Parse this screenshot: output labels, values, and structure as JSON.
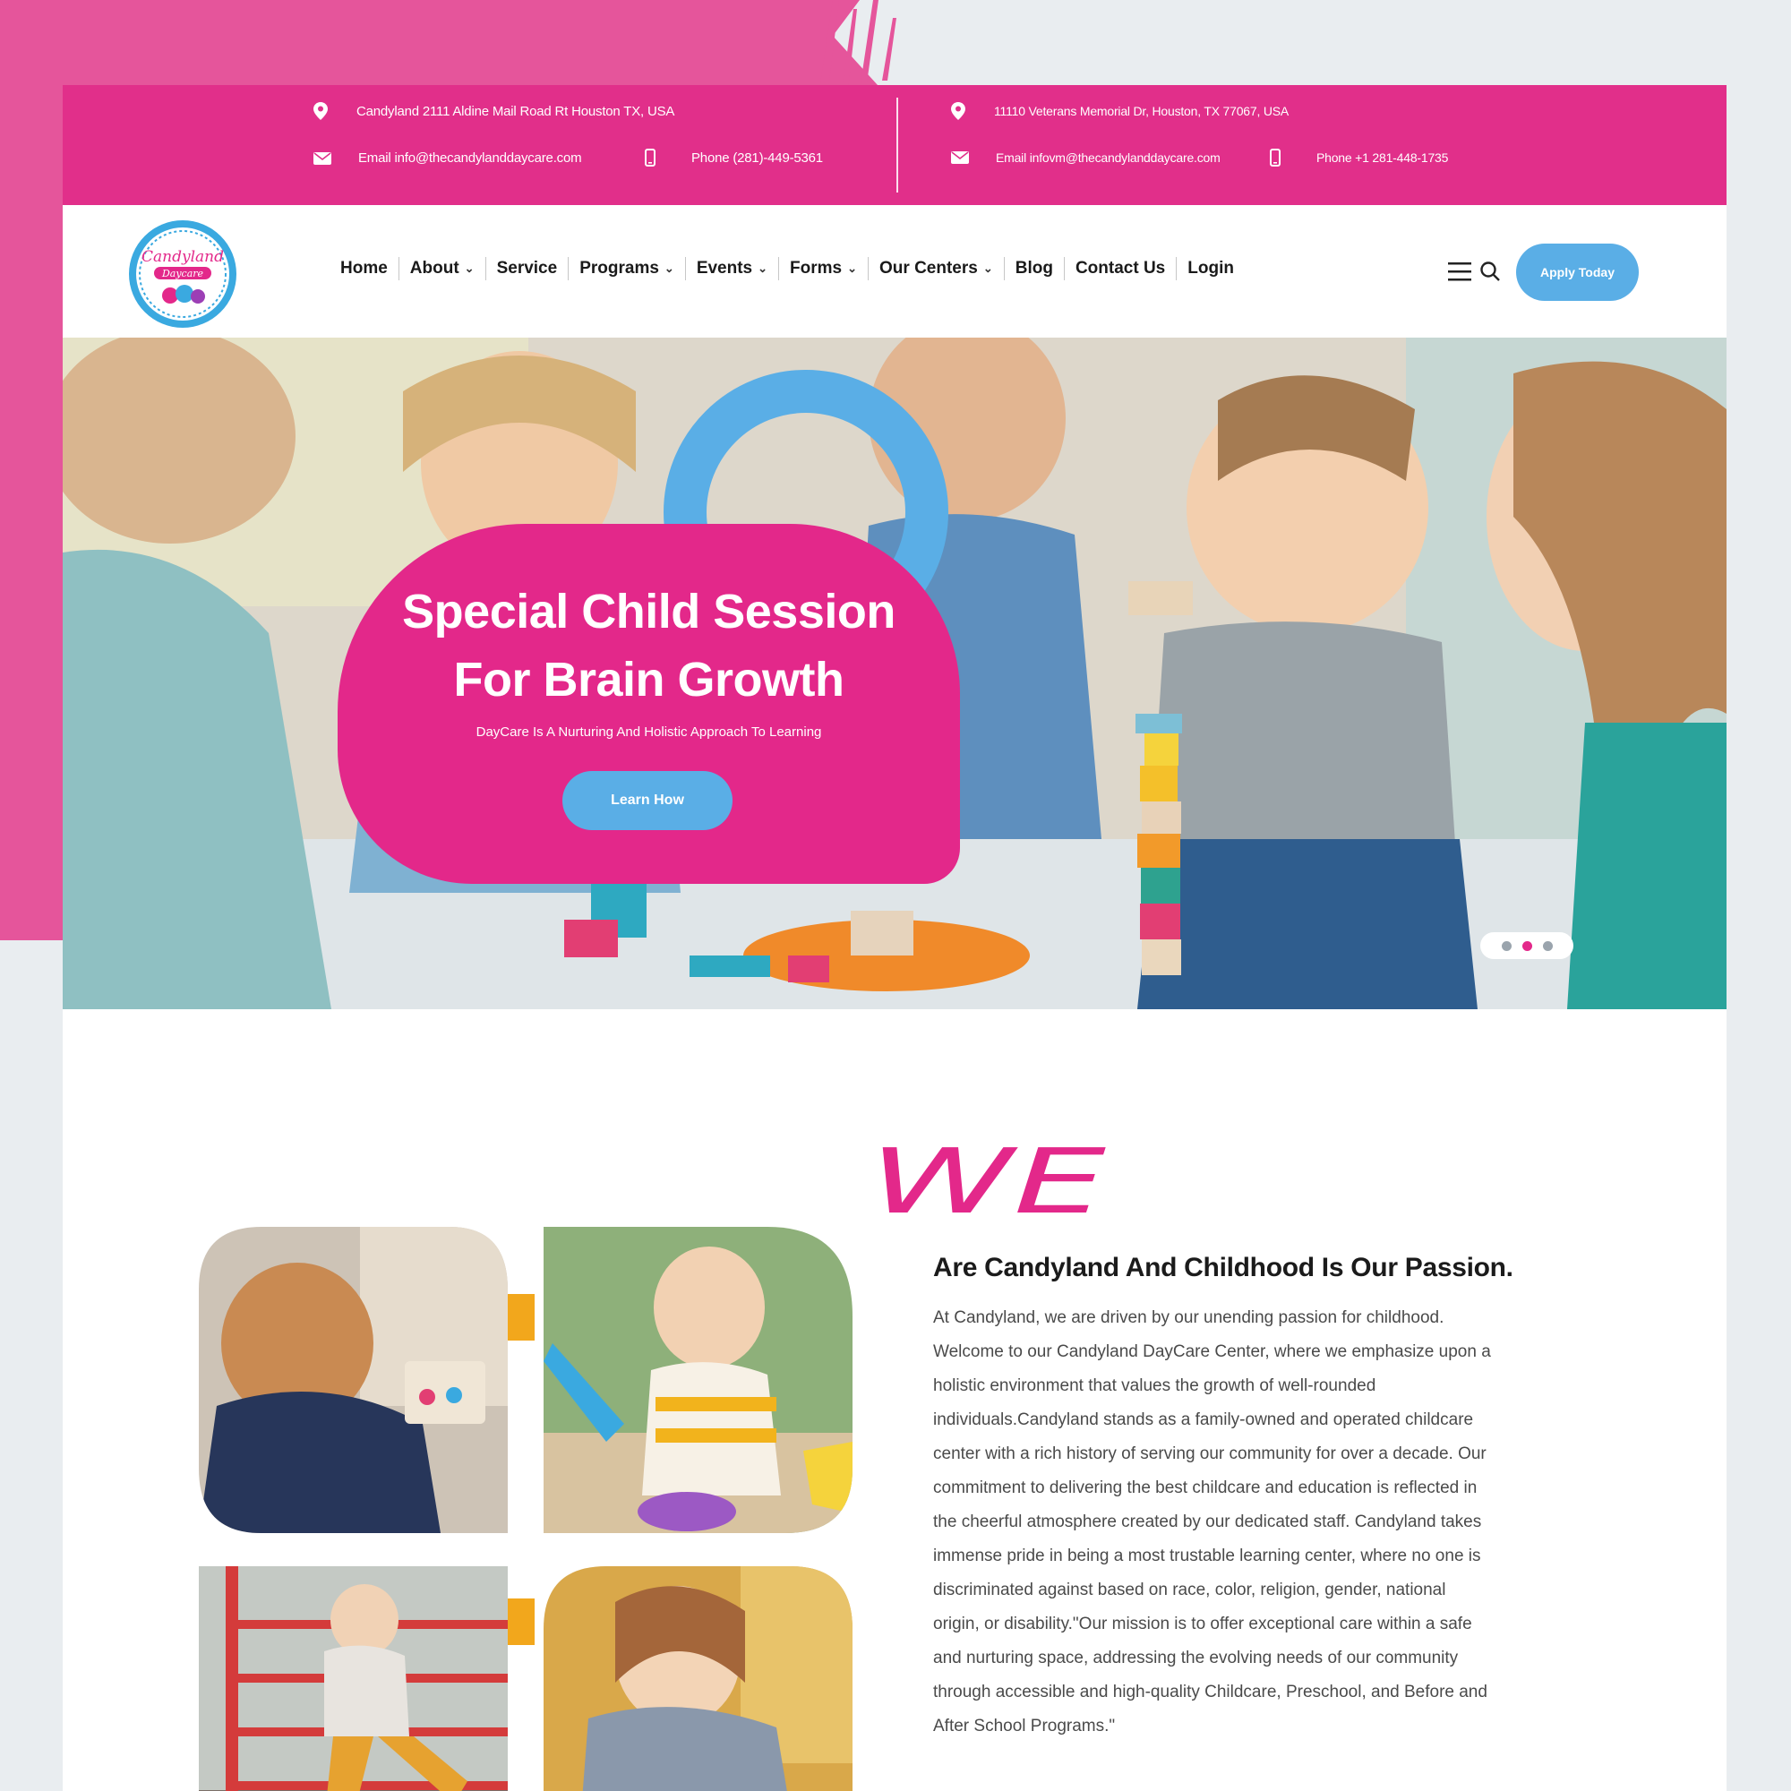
{
  "topbar": {
    "left": {
      "address": "Candyland 2111 Aldine Mail Road Rt Houston TX, USA",
      "email": "Email info@thecandylanddaycare.com",
      "phone": "Phone (281)-449-5361"
    },
    "right": {
      "address": "11110 Veterans Memorial Dr, Houston, TX 77067, USA",
      "email": "Email infovm@thecandylanddaycare.com",
      "phone": "Phone +1 281-448-1735"
    }
  },
  "logo": {
    "line1": "Candyland",
    "line2": "Daycare"
  },
  "nav": {
    "items": [
      {
        "label": "Home"
      },
      {
        "label": "About",
        "dropdown": "⌄"
      },
      {
        "label": "Service"
      },
      {
        "label": "Programs",
        "dropdown": "⌄"
      },
      {
        "label": "Events",
        "dropdown": "⌄"
      },
      {
        "label": "Forms",
        "dropdown": "⌄"
      },
      {
        "label": "Our Centers",
        "dropdown": "⌄"
      },
      {
        "label": "Blog"
      },
      {
        "label": "Contact Us"
      },
      {
        "label": "Login"
      }
    ],
    "apply_label": "Apply Today"
  },
  "hero": {
    "title_line1": "Special Child Session",
    "title_line2": "For Brain Growth",
    "subtitle": "DayCare Is A Nurturing And Holistic Approach To Learning",
    "cta": "Learn How",
    "slides_total": 3,
    "active_slide": 2
  },
  "about": {
    "script_word": "WE",
    "heading": "Are Candyland And Childhood Is Our Passion.",
    "lines": [
      "At Candyland, we are driven by our unending passion for childhood.",
      "Welcome to our Candyland DayCare Center, where we emphasize upon a",
      "holistic environment that values the growth of well-rounded",
      "individuals.Candyland stands as a family-owned and operated childcare",
      "center with a rich history of serving our community for over a decade. Our",
      "commitment to delivering the best childcare and education is reflected in",
      "the cheerful atmosphere created by our dedicated staff. Candyland takes",
      "immense pride in being a most trustable learning center, where no one is",
      "discriminated against based on race, color, religion, gender, national",
      "origin, or disability.\"Our mission is to offer exceptional care within a safe",
      "and nurturing space, addressing the evolving needs of our community",
      "through accessible and high-quality Childcare, Preschool, and Before and",
      "After School Programs.\""
    ]
  },
  "colors": {
    "brand_pink": "#e3288a",
    "accent_blue": "#5aaee6",
    "accent_yellow": "#f2a71c",
    "backdrop_pink": "#e5559b"
  }
}
